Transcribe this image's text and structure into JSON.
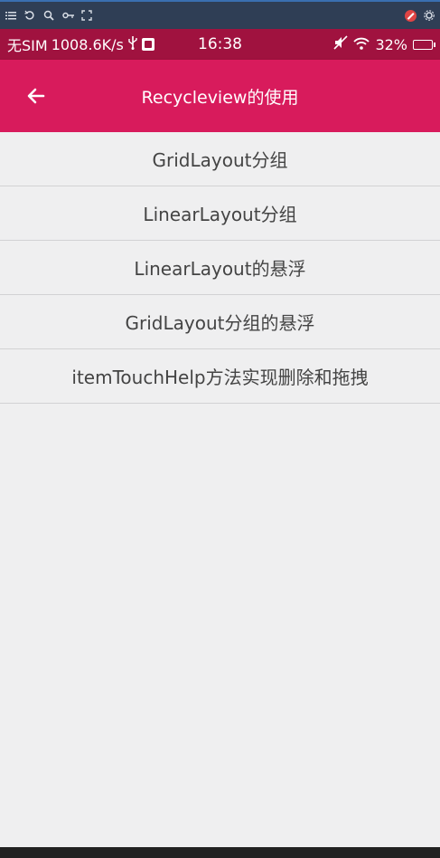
{
  "emulator_toolbar": {
    "left_icons": [
      "list-icon",
      "rotate-icon",
      "zoom-icon",
      "key-icon",
      "fullscreen-icon"
    ],
    "right_icons": [
      "blocked-icon",
      "settings-icon"
    ]
  },
  "status_bar": {
    "carrier": "无SIM",
    "speed": "1008.6K/s",
    "time": "16:38",
    "battery": "32%"
  },
  "app_bar": {
    "title": "Recycleview的使用"
  },
  "list": {
    "items": [
      "GridLayout分组",
      "LinearLayout分组",
      "LinearLayout的悬浮",
      "GridLayout分组的悬浮",
      "itemTouchHelp方法实现删除和拖拽"
    ]
  },
  "colors": {
    "app_bar": "#d81b5c",
    "status_bar": "#a0123f",
    "background": "#efeff0"
  }
}
